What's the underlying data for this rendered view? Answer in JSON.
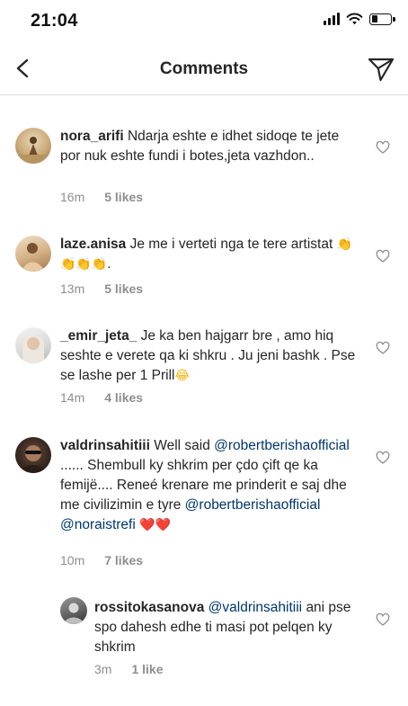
{
  "status": {
    "time": "21:04"
  },
  "header": {
    "title": "Comments"
  },
  "comments": [
    {
      "username": "nora_arifi",
      "text": "Ndarja eshte e idhet sidoqe te jete por nuk eshte fundi i botes,jeta vazhdon..",
      "time": "16m",
      "likes": "5 likes"
    },
    {
      "username": "laze.anisa",
      "text": "Je me i verteti nga te tere artistat",
      "emoji": "👏👏👏👏",
      "text_end": ".",
      "time": "13m",
      "likes": "5 likes"
    },
    {
      "username": "_emir_jeta_",
      "text": "Je ka ben hajgarr bre , amo hiq seshte e verete qa ki shkru . Ju jeni bashk . Pse se lashe per 1 Prill",
      "emoji": "😂",
      "time": "14m",
      "likes": "4 likes"
    },
    {
      "username": "valdrinsahitiii",
      "text_a": "Well said",
      "mention_1": "@robertberishaofficial",
      "text_b": "...... Shembull ky shkrim per çdo çift qe ka femijë.... Reneé krenare me prinderit e saj dhe me civilizimin e tyre",
      "mention_2": "@robertberishaofficial",
      "mention_3": "@noraistrefi",
      "emoji": "❤️❤️",
      "time": "10m",
      "likes": "7 likes"
    },
    {
      "username": "rossitokasanova",
      "mention": "@valdrinsahitiii",
      "text": "ani pse spo dahesh edhe ti masi pot pelqen ky shkrim",
      "time": "3m",
      "likes": "1 like"
    }
  ],
  "colors": {
    "mention": "#00376b",
    "meta": "#8e8e8e",
    "divider": "#dbdbdb"
  },
  "icons": [
    "back-arrow-icon",
    "send-icon",
    "heart-icon",
    "wifi-icon",
    "battery-icon",
    "signal-icon"
  ]
}
